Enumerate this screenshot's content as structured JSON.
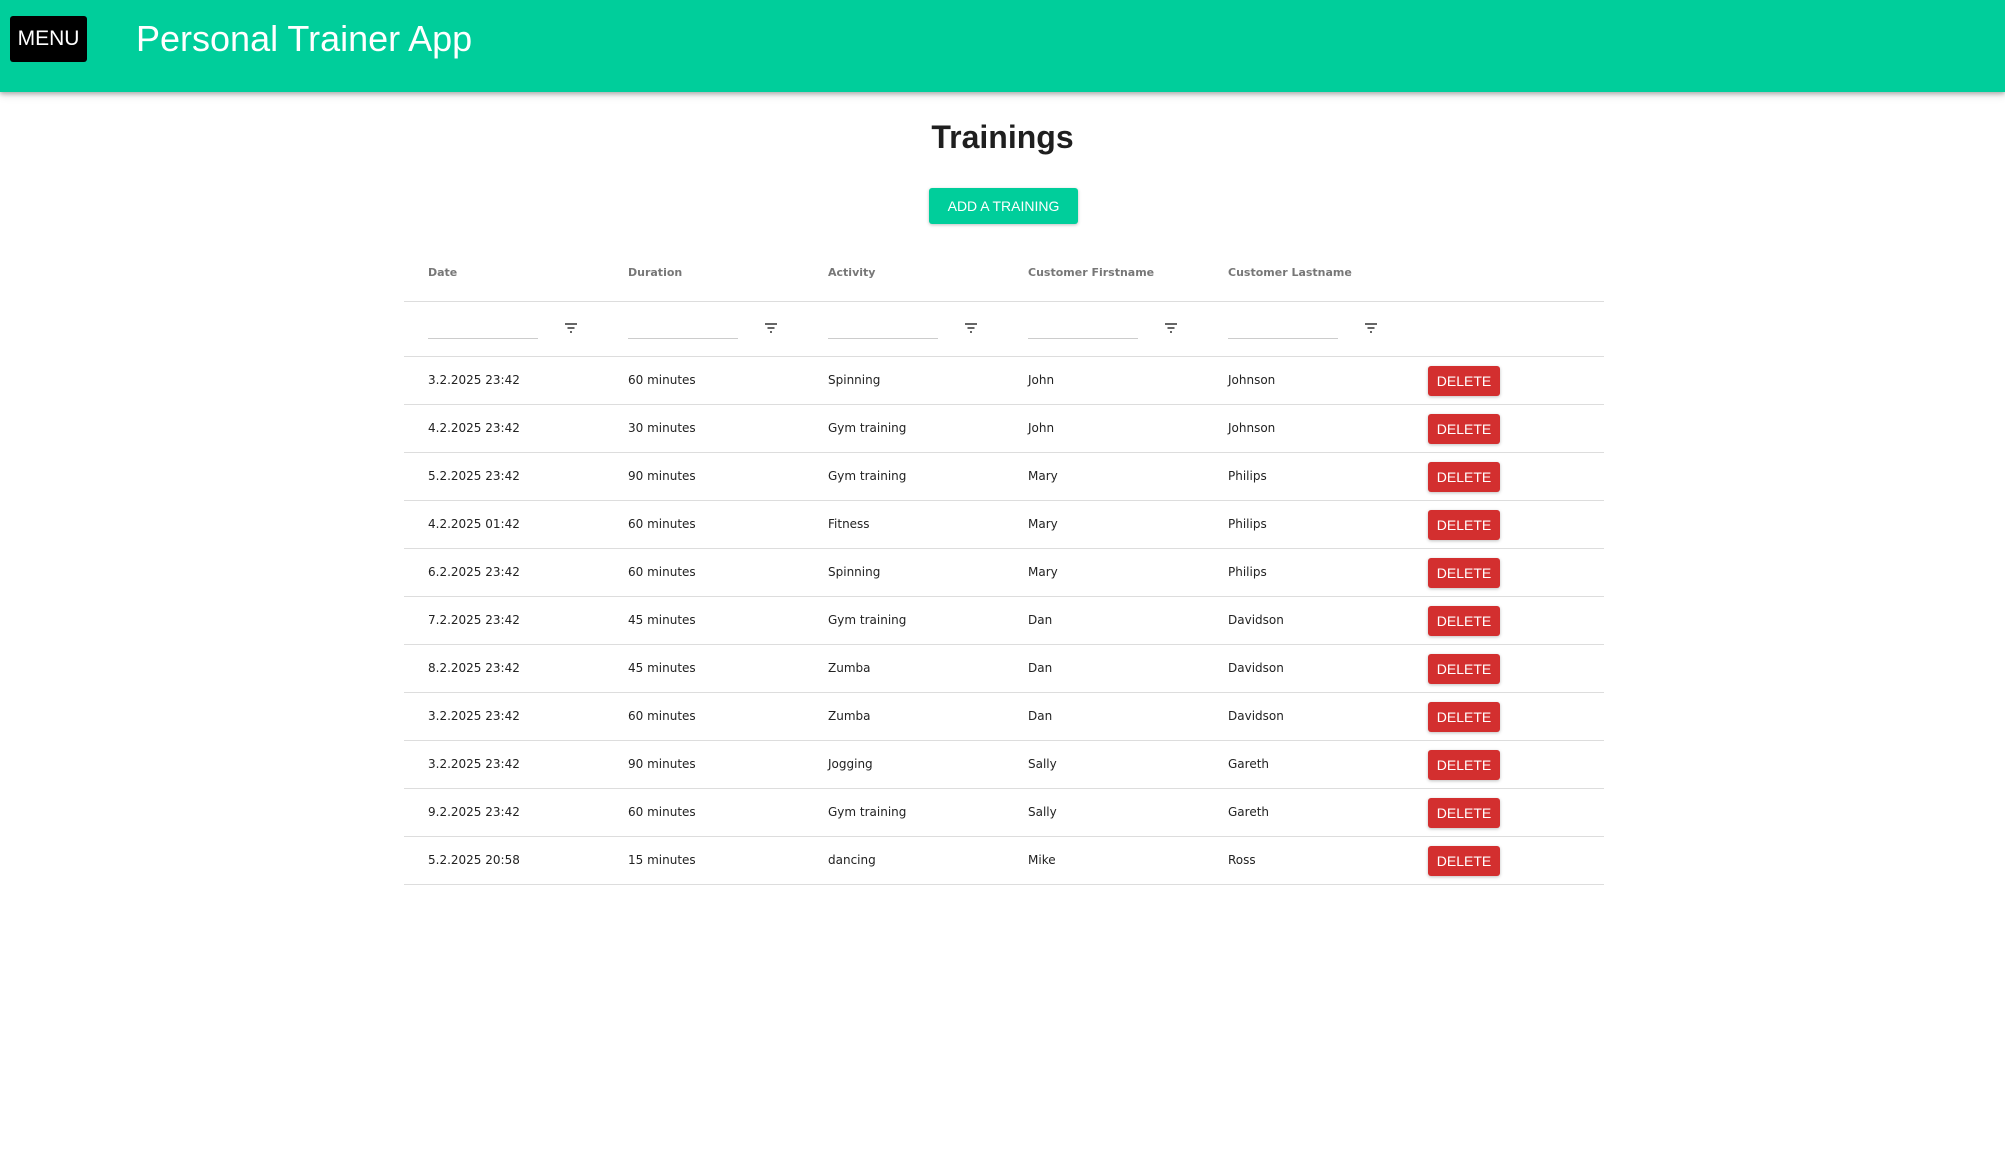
{
  "appbar": {
    "menu_label": "MENU",
    "title": "Personal Trainer App"
  },
  "page": {
    "title": "Trainings",
    "add_button_label": "ADD A TRAINING"
  },
  "table": {
    "columns": [
      "Date",
      "Duration",
      "Activity",
      "Customer Firstname",
      "Customer Lastname"
    ],
    "delete_label": "DELETE",
    "rows": [
      {
        "date": "3.2.2025 23:42",
        "duration": "60 minutes",
        "activity": "Spinning",
        "firstname": "John",
        "lastname": "Johnson"
      },
      {
        "date": "4.2.2025 23:42",
        "duration": "30 minutes",
        "activity": "Gym training",
        "firstname": "John",
        "lastname": "Johnson"
      },
      {
        "date": "5.2.2025 23:42",
        "duration": "90 minutes",
        "activity": "Gym training",
        "firstname": "Mary",
        "lastname": "Philips"
      },
      {
        "date": "4.2.2025 01:42",
        "duration": "60 minutes",
        "activity": "Fitness",
        "firstname": "Mary",
        "lastname": "Philips"
      },
      {
        "date": "6.2.2025 23:42",
        "duration": "60 minutes",
        "activity": "Spinning",
        "firstname": "Mary",
        "lastname": "Philips"
      },
      {
        "date": "7.2.2025 23:42",
        "duration": "45 minutes",
        "activity": "Gym training",
        "firstname": "Dan",
        "lastname": "Davidson"
      },
      {
        "date": "8.2.2025 23:42",
        "duration": "45 minutes",
        "activity": "Zumba",
        "firstname": "Dan",
        "lastname": "Davidson"
      },
      {
        "date": "3.2.2025 23:42",
        "duration": "60 minutes",
        "activity": "Zumba",
        "firstname": "Dan",
        "lastname": "Davidson"
      },
      {
        "date": "3.2.2025 23:42",
        "duration": "90 minutes",
        "activity": "Jogging",
        "firstname": "Sally",
        "lastname": "Gareth"
      },
      {
        "date": "9.2.2025 23:42",
        "duration": "60 minutes",
        "activity": "Gym training",
        "firstname": "Sally",
        "lastname": "Gareth"
      },
      {
        "date": "5.2.2025 20:58",
        "duration": "15 minutes",
        "activity": "dancing",
        "firstname": "Mike",
        "lastname": "Ross"
      }
    ]
  },
  "icons": {
    "filter": "filter-icon",
    "menu": "menu-button"
  },
  "colors": {
    "brand": "#00ce9b",
    "danger": "#d32f2f",
    "menu_bg": "#000000"
  }
}
